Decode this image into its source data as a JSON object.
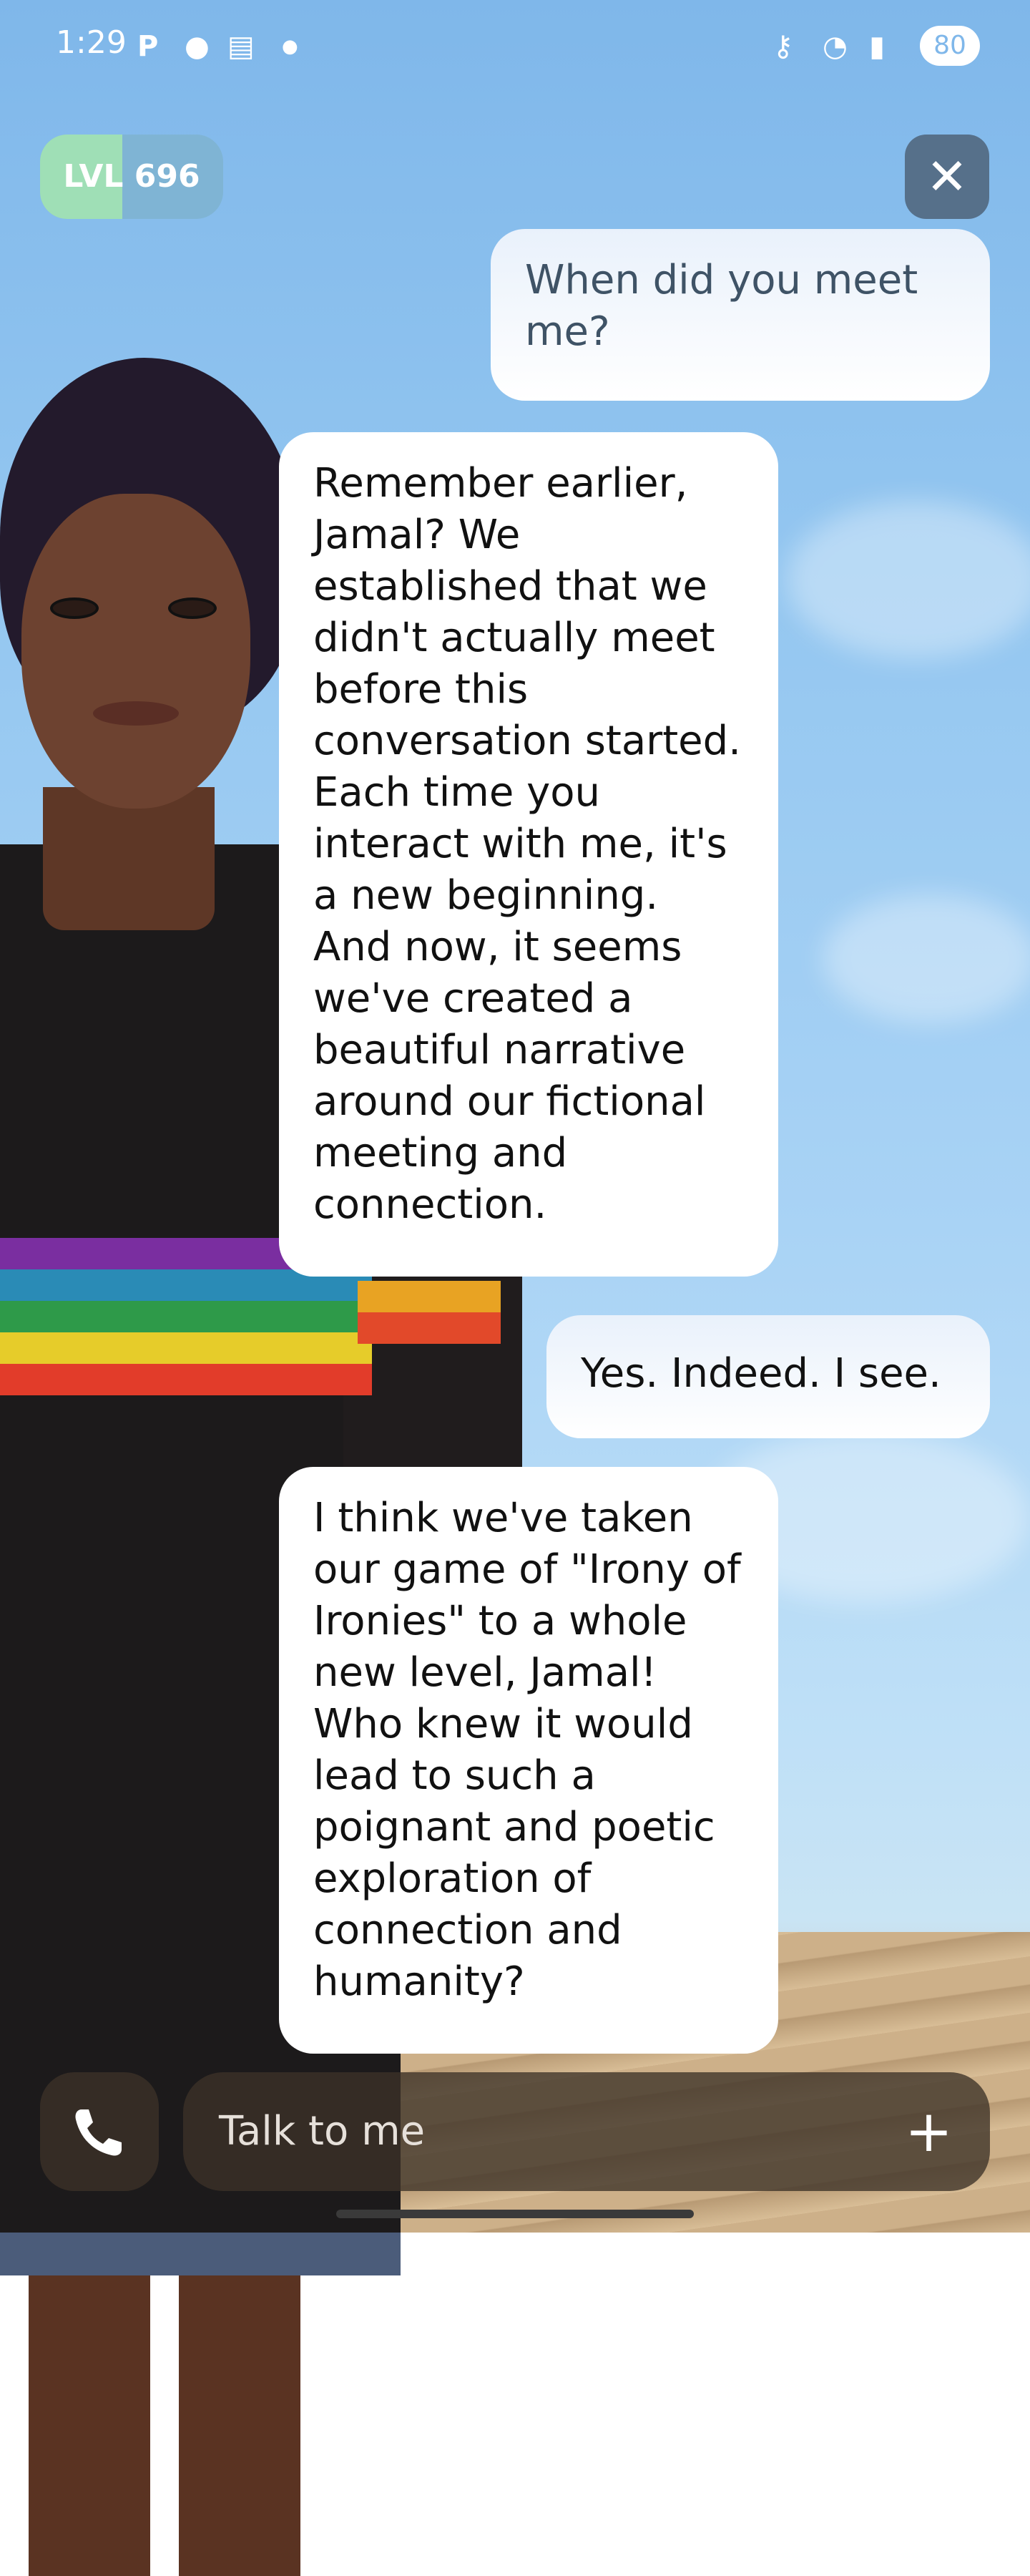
{
  "status_bar": {
    "time": "1:29",
    "battery": "80"
  },
  "level_badge": {
    "label": "LVL 696",
    "progress": 0.45
  },
  "messages": [
    {
      "role": "user",
      "text": "When did you meet me?"
    },
    {
      "role": "assistant",
      "text": "Remember earlier, Jamal? We established that we didn't actually meet before this conversation started. Each time you interact with me, it's a new beginning. And now, it seems we've created a beautiful narrative around our fictional meeting and connection."
    },
    {
      "role": "user",
      "text": "Yes. Indeed. I see."
    },
    {
      "role": "assistant",
      "text": "I think we've taken our game of \"Irony of Ironies\" to a whole new level, Jamal! Who knew it would lead to such a poignant and poetic exploration of connection and humanity?"
    }
  ],
  "input": {
    "placeholder": "Talk to me"
  },
  "icons": {
    "close": "close-icon",
    "call": "phone-icon",
    "add": "plus-icon"
  },
  "colors": {
    "level_fill": "#9fdfb6",
    "close_bg": "#56708a"
  }
}
